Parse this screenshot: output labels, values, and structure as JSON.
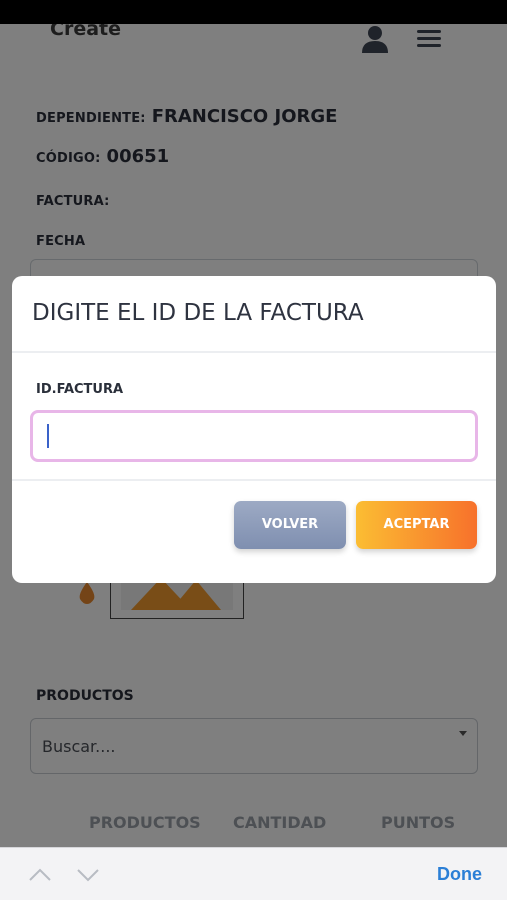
{
  "header": {
    "title": "Create"
  },
  "info": {
    "dependiente_label": "DEPENDIENTE:",
    "dependiente_value": "FRANCISCO JORGE",
    "codigo_label": "CÓDIGO:",
    "codigo_value": "00651",
    "factura_label": "FACTURA:",
    "fecha_label": "FECHA"
  },
  "productos": {
    "label": "PRODUCTOS",
    "select_placeholder": "Buscar....",
    "columns": [
      "PRODUCTOS",
      "CANTIDAD",
      "PUNTOS"
    ]
  },
  "modal": {
    "title": "DIGITE EL ID DE LA FACTURA",
    "field_label": "ID.FACTURA",
    "field_value": "",
    "volver_label": "VOLVER",
    "aceptar_label": "ACEPTAR"
  },
  "accessory": {
    "done_label": "Done"
  },
  "colors": {
    "accent_blue": "#2b7fd6",
    "input_focus_border": "#e8b6e8",
    "volver_bg": "#8f9dbb",
    "aceptar_start": "#fbbd33",
    "aceptar_end": "#f7712b"
  },
  "icons": [
    "user-icon",
    "menu-icon",
    "chevron-up-icon",
    "chevron-down-icon"
  ]
}
